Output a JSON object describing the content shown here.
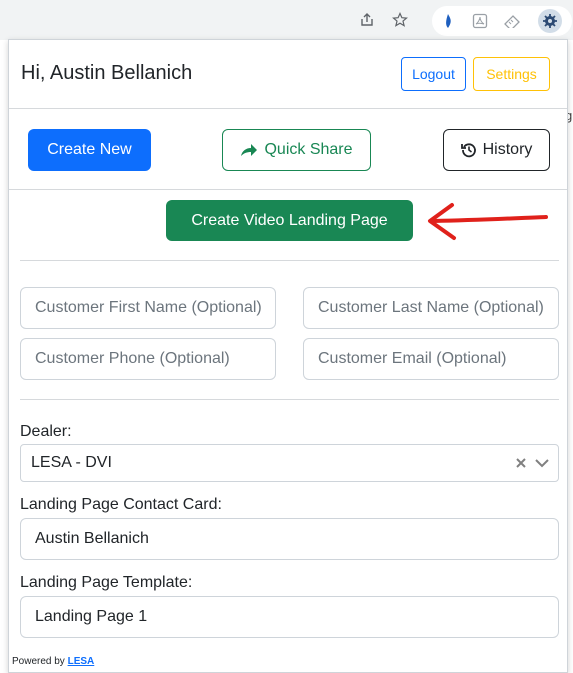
{
  "browser": {
    "icons": [
      "share-icon",
      "star-icon",
      "extension-blue-icon",
      "pdf-icon",
      "ruler-icon",
      "gear-extension-icon"
    ]
  },
  "background_page": {
    "peek_text": "g"
  },
  "header": {
    "greeting": "Hi, Austin Bellanich",
    "logout_label": "Logout",
    "settings_label": "Settings"
  },
  "actions": {
    "create_new_label": "Create New",
    "quick_share_label": "Quick Share",
    "history_label": "History",
    "create_video_label": "Create Video Landing Page"
  },
  "customer": {
    "first_name_placeholder": "Customer First Name (Optional)",
    "last_name_placeholder": "Customer Last Name (Optional)",
    "phone_placeholder": "Customer Phone (Optional)",
    "email_placeholder": "Customer Email (Optional)"
  },
  "dealer": {
    "label": "Dealer:",
    "selected": "LESA - DVI"
  },
  "contact_card": {
    "label": "Landing Page Contact Card:",
    "value": "Austin Bellanich"
  },
  "template": {
    "label": "Landing Page Template:",
    "value": "Landing Page 1"
  },
  "footer": {
    "powered_by": "Powered by ",
    "brand": "LESA"
  },
  "colors": {
    "primary": "#0d6efd",
    "success": "#198754",
    "warning": "#ffc107",
    "annotation_arrow": "#e0211b"
  }
}
